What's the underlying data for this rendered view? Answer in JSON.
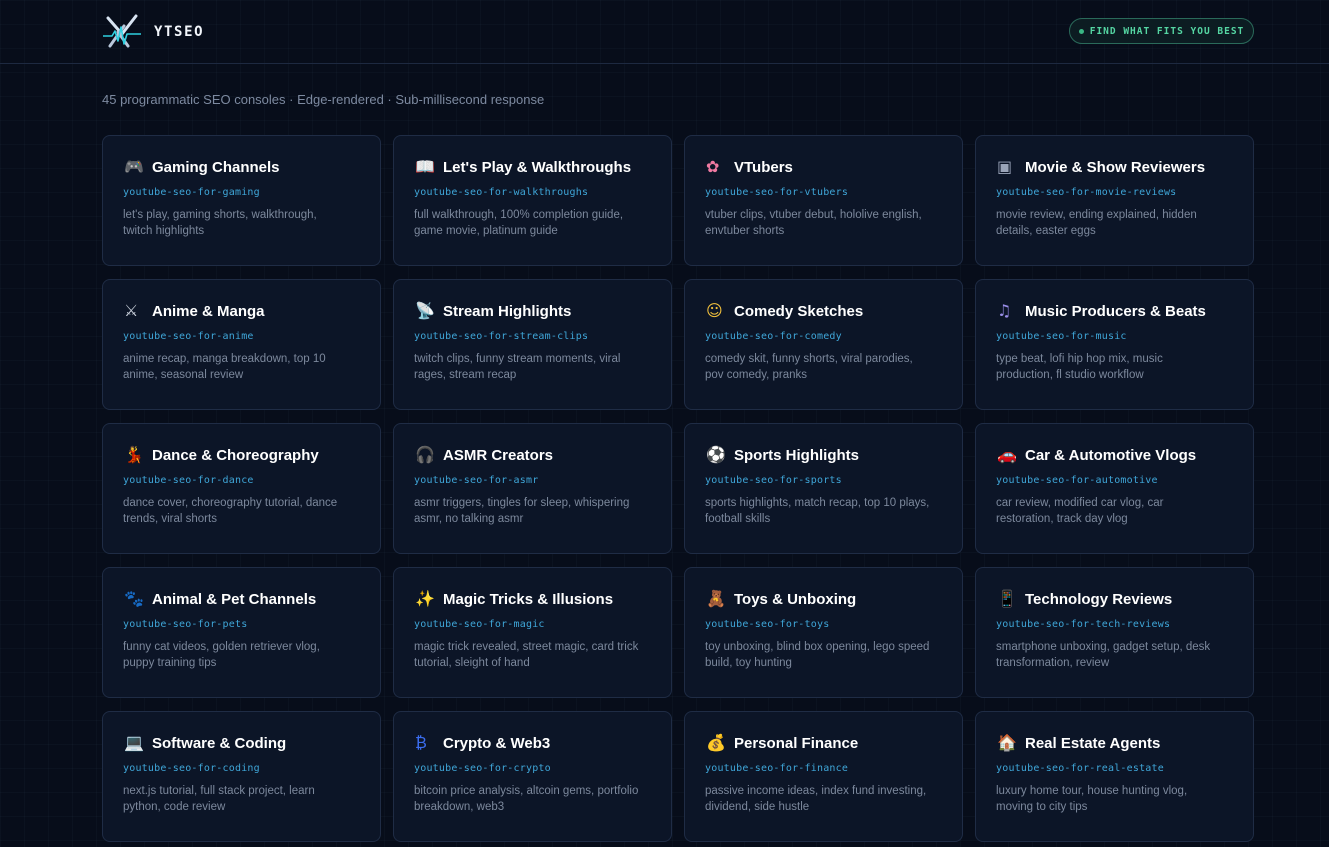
{
  "header": {
    "brand": "YTSEO",
    "cta_label": "FIND WHAT FITS YOU BEST"
  },
  "subtitle": "45 programmatic SEO consoles · Edge-rendered · Sub-millisecond response",
  "colors": {
    "background": "#070d1a",
    "card": "#0c1527",
    "accent_slug": "#3fa6d8",
    "accent_cta": "#55d6a3"
  },
  "cards": [
    {
      "icon": "🎮",
      "icon_name": "gamepad-icon",
      "color": "#a87ce8",
      "title": "Gaming Channels",
      "slug": "youtube-seo-for-gaming",
      "desc": "let's play, gaming shorts, walkthrough, twitch highlights"
    },
    {
      "icon": "📖",
      "icon_name": "map-icon",
      "color": "#5fa8e0",
      "title": "Let's Play & Walkthroughs",
      "slug": "youtube-seo-for-walkthroughs",
      "desc": "full walkthrough, 100% completion guide, game movie, platinum guide"
    },
    {
      "icon": "✿",
      "icon_name": "flower-icon",
      "color": "#f07aa2",
      "title": "VTubers",
      "slug": "youtube-seo-for-vtubers",
      "desc": "vtuber clips, vtuber debut, hololive english, envtuber shorts"
    },
    {
      "icon": "▣",
      "icon_name": "clapperboard-icon",
      "color": "#9aa4b8",
      "title": "Movie & Show Reviewers",
      "slug": "youtube-seo-for-movie-reviews",
      "desc": "movie review, ending explained, hidden details, easter eggs"
    },
    {
      "icon": "⚔",
      "icon_name": "crossed-swords-icon",
      "color": "#c6cdd8",
      "title": "Anime & Manga",
      "slug": "youtube-seo-for-anime",
      "desc": "anime recap, manga breakdown, top 10 anime, seasonal review"
    },
    {
      "icon": "📡",
      "icon_name": "satellite-dish-icon",
      "color": "#c6cdd8",
      "title": "Stream Highlights",
      "slug": "youtube-seo-for-stream-clips",
      "desc": "twitch clips, funny stream moments, viral rages, stream recap"
    },
    {
      "icon": "☺",
      "icon_name": "laughing-face-icon",
      "color": "#f4c23c",
      "title": "Comedy Sketches",
      "slug": "youtube-seo-for-comedy",
      "desc": "comedy skit, funny shorts, viral parodies, pov comedy, pranks"
    },
    {
      "icon": "♫",
      "icon_name": "music-notes-icon",
      "color": "#9a8ee8",
      "title": "Music Producers & Beats",
      "slug": "youtube-seo-for-music",
      "desc": "type beat, lofi hip hop mix, music production, fl studio workflow"
    },
    {
      "icon": "💃",
      "icon_name": "dancer-icon",
      "color": "#e0443c",
      "title": "Dance & Choreography",
      "slug": "youtube-seo-for-dance",
      "desc": "dance cover, choreography tutorial, dance trends, viral shorts"
    },
    {
      "icon": "🎧",
      "icon_name": "headphones-icon",
      "color": "#d4d9e2",
      "title": "ASMR Creators",
      "slug": "youtube-seo-for-asmr",
      "desc": "asmr triggers, tingles for sleep, whispering asmr, no talking asmr"
    },
    {
      "icon": "⚽",
      "icon_name": "soccer-ball-icon",
      "color": "#8fa8e8",
      "title": "Sports Highlights",
      "slug": "youtube-seo-for-sports",
      "desc": "sports highlights, match recap, top 10 plays, football skills"
    },
    {
      "icon": "🚗",
      "icon_name": "car-icon",
      "color": "#e0443c",
      "title": "Car & Automotive Vlogs",
      "slug": "youtube-seo-for-automotive",
      "desc": "car review, modified car vlog, car restoration, track day vlog"
    },
    {
      "icon": "🐾",
      "icon_name": "paw-prints-icon",
      "color": "#9aa4b8",
      "title": "Animal & Pet Channels",
      "slug": "youtube-seo-for-pets",
      "desc": "funny cat videos, golden retriever vlog, puppy training tips"
    },
    {
      "icon": "✨",
      "icon_name": "magic-wand-icon",
      "color": "#f4c23c",
      "title": "Magic Tricks & Illusions",
      "slug": "youtube-seo-for-magic",
      "desc": "magic trick revealed, street magic, card trick tutorial, sleight of hand"
    },
    {
      "icon": "🧸",
      "icon_name": "teddy-bear-icon",
      "color": "#d9964a",
      "title": "Toys & Unboxing",
      "slug": "youtube-seo-for-toys",
      "desc": "toy unboxing, blind box opening, lego speed build, toy hunting"
    },
    {
      "icon": "📱",
      "icon_name": "smartphone-icon",
      "color": "#8f96c8",
      "title": "Technology Reviews",
      "slug": "youtube-seo-for-tech-reviews",
      "desc": "smartphone unboxing, gadget setup, desk transformation, review"
    },
    {
      "icon": "💻",
      "icon_name": "laptop-icon",
      "color": "#6fb6e8",
      "title": "Software & Coding",
      "slug": "youtube-seo-for-coding",
      "desc": "next.js tutorial, full stack project, learn python, code review"
    },
    {
      "icon": "₿",
      "icon_name": "bitcoin-icon",
      "color": "#3b6df0",
      "title": "Crypto & Web3",
      "slug": "youtube-seo-for-crypto",
      "desc": "bitcoin price analysis, altcoin gems, portfolio breakdown, web3"
    },
    {
      "icon": "💰",
      "icon_name": "money-bag-icon",
      "color": "#e8b040",
      "title": "Personal Finance",
      "slug": "youtube-seo-for-finance",
      "desc": "passive income ideas, index fund investing, dividend, side hustle"
    },
    {
      "icon": "🏠",
      "icon_name": "house-icon",
      "color": "#e07a3c",
      "title": "Real Estate Agents",
      "slug": "youtube-seo-for-real-estate",
      "desc": "luxury home tour, house hunting vlog, moving to city tips"
    }
  ]
}
